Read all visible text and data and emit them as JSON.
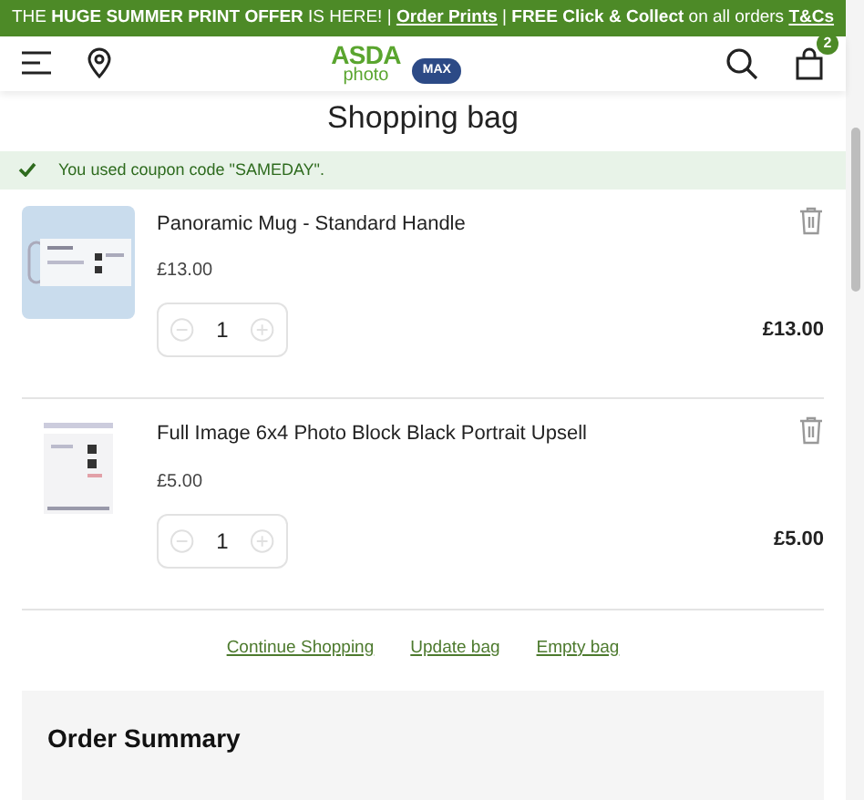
{
  "banner": [
    {
      "kind": "text",
      "text": "THE "
    },
    {
      "kind": "bold",
      "text": "HUGE SUMMER PRINT OFFER"
    },
    {
      "kind": "text",
      "text": " IS HERE! | "
    },
    {
      "kind": "link",
      "text": "Order Prints"
    },
    {
      "kind": "text",
      "text": " | "
    },
    {
      "kind": "bold",
      "text": "FREE Click & Collect"
    },
    {
      "kind": "text",
      "text": " on all orders "
    },
    {
      "kind": "link",
      "text": "T&Cs"
    }
  ],
  "header": {
    "logo_brand": "ASDA",
    "logo_sub": "photo",
    "partner_badge": "MAX",
    "cart_count": "2"
  },
  "page_title": "Shopping bag",
  "notice": "You used coupon code \"SAMEDAY\".",
  "items": [
    {
      "name": "Panoramic Mug - Standard Handle",
      "price": "£13.00",
      "quantity": "1",
      "total": "£13.00"
    },
    {
      "name": "Full Image 6x4 Photo Block Black Portrait Upsell",
      "price": "£5.00",
      "quantity": "1",
      "total": "£5.00"
    }
  ],
  "actions": [
    "Continue Shopping",
    "Update bag",
    "Empty bag"
  ],
  "order_summary": {
    "title": "Order Summary"
  }
}
